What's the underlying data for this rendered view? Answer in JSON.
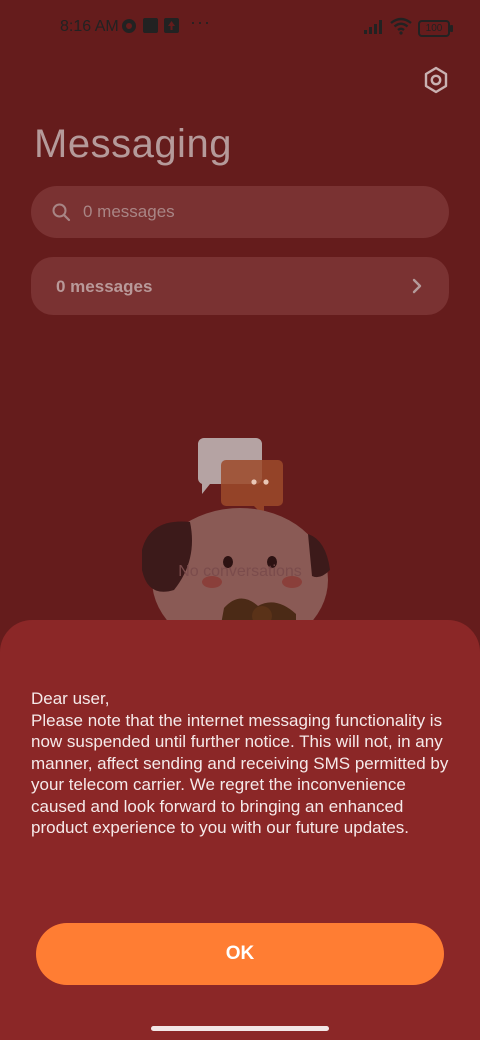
{
  "status_bar": {
    "time": "8:16 AM",
    "more_dots": "···",
    "battery_level": "100",
    "icons": [
      "media-icon",
      "square-icon",
      "notification-icon",
      "signal-icon",
      "wifi-icon",
      "battery-icon"
    ]
  },
  "header": {
    "title": "Messaging",
    "settings_icon": "settings-hexagon-icon"
  },
  "search": {
    "placeholder": "0 messages",
    "icon": "search-icon"
  },
  "summary_card": {
    "label": "0 messages",
    "icon": "chevron-right-icon"
  },
  "empty_state": {
    "text": "No conversations",
    "illustration": "puppy-with-chat-bubbles"
  },
  "dialog": {
    "message": "Dear user,\nPlease note that the internet messaging functionality is now suspended until further notice. This will not, in any manner, affect sending and receiving SMS permitted by your telecom carrier. We regret the inconvenience caused and look forward to bringing an enhanced product experience to you with our future updates.",
    "ok_label": "OK"
  },
  "colors": {
    "background": "#651c1c",
    "sheet": "#8b2727",
    "accent": "#ff7d33",
    "card": "#7a3232"
  }
}
